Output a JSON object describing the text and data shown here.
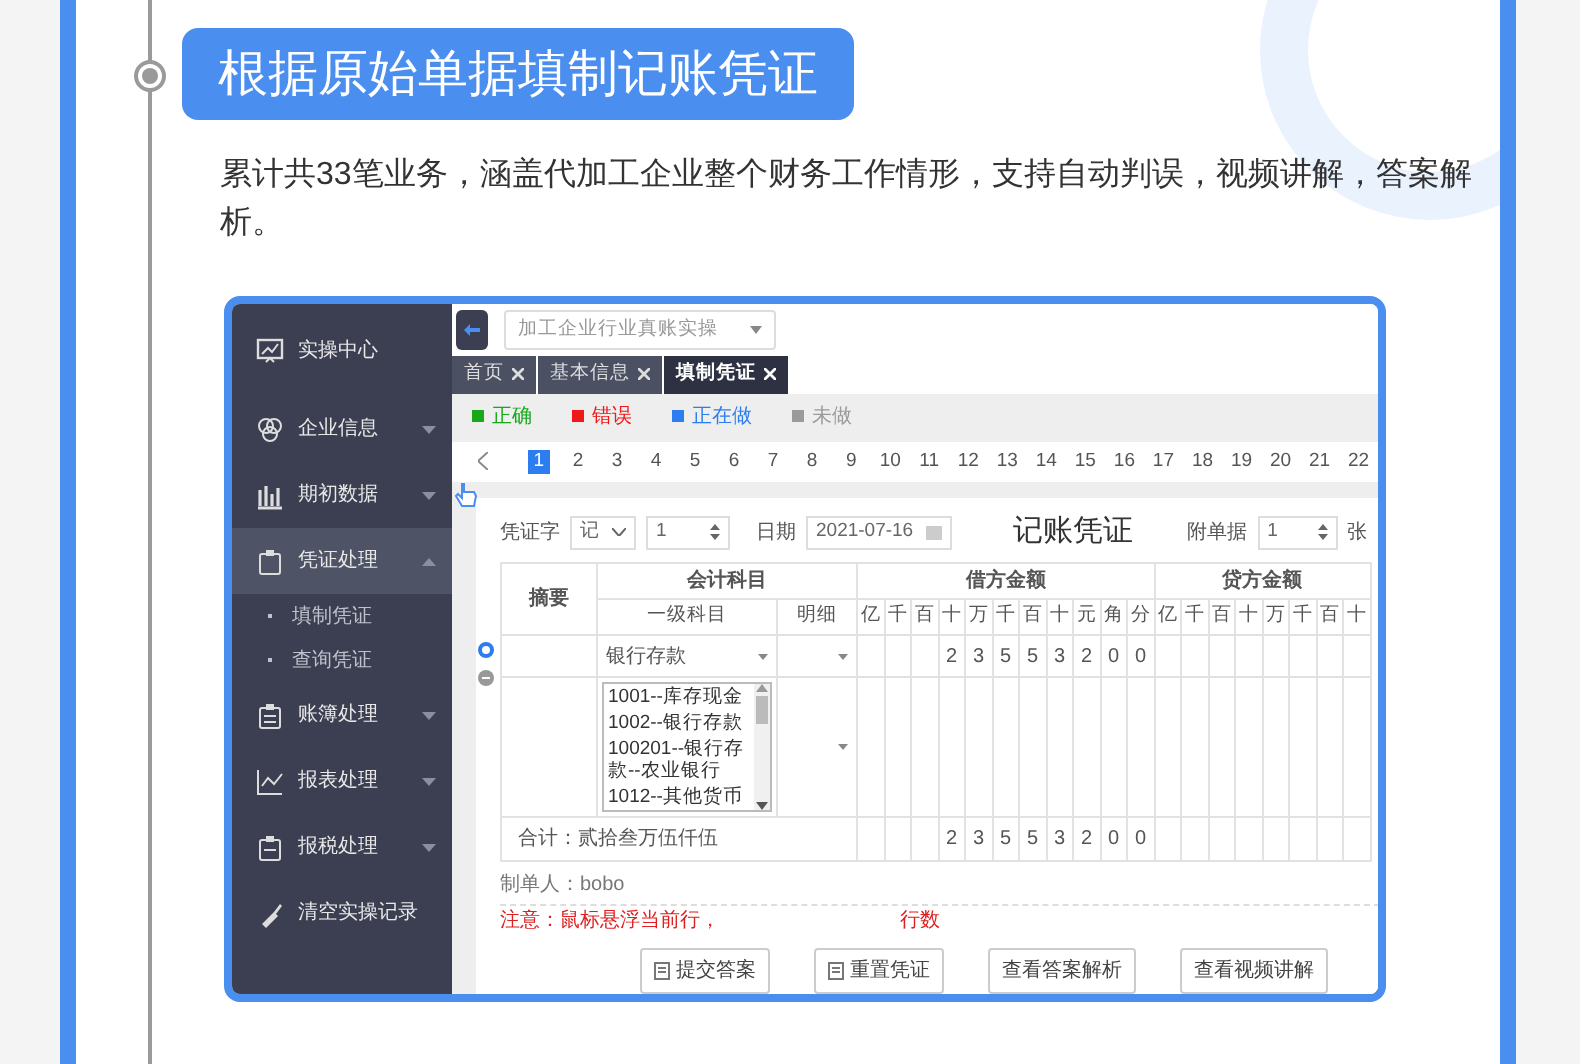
{
  "header": {
    "title": "根据原始单据填制记账凭证",
    "description": "累计共33笔业务，涵盖代加工企业整个财务工作情形，支持自动判误，视频讲解，答案解析。"
  },
  "app": {
    "sidebar": {
      "items": [
        {
          "label": "实操中心",
          "kind": "link",
          "selected": false
        },
        {
          "label": "企业信息",
          "kind": "group",
          "selected": false,
          "expanded": false
        },
        {
          "label": "期初数据",
          "kind": "group",
          "selected": false,
          "expanded": false
        },
        {
          "label": "凭证处理",
          "kind": "group",
          "selected": true,
          "expanded": true,
          "children": [
            {
              "label": "填制凭证",
              "selected": false
            },
            {
              "label": "查询凭证",
              "selected": false
            }
          ]
        },
        {
          "label": "账簿处理",
          "kind": "group",
          "selected": false,
          "expanded": false
        },
        {
          "label": "报表处理",
          "kind": "group",
          "selected": false,
          "expanded": false
        },
        {
          "label": "报税处理",
          "kind": "group",
          "selected": false,
          "expanded": false
        },
        {
          "label": "清空实操记录",
          "kind": "link",
          "selected": false
        }
      ]
    },
    "top_select": {
      "value": "加工企业行业真账实操"
    },
    "tabs": [
      {
        "label": "首页",
        "selected": false
      },
      {
        "label": "基本信息",
        "selected": false
      },
      {
        "label": "填制凭证",
        "selected": true
      }
    ],
    "legend": [
      {
        "label": "正确",
        "color": "#18a81c"
      },
      {
        "label": "错误",
        "color": "#f01818"
      },
      {
        "label": "正在做",
        "color": "#2c7df0"
      },
      {
        "label": "未做",
        "color": "#9a9a9a"
      }
    ],
    "pagination": {
      "pages": [
        {
          "label": "1",
          "selected": true
        },
        {
          "label": "2",
          "selected": false
        },
        {
          "label": "3",
          "selected": false
        },
        {
          "label": "4",
          "selected": false
        },
        {
          "label": "5",
          "selected": false
        },
        {
          "label": "6",
          "selected": false
        },
        {
          "label": "7",
          "selected": false
        },
        {
          "label": "8",
          "selected": false
        },
        {
          "label": "9",
          "selected": false
        },
        {
          "label": "10",
          "selected": false
        },
        {
          "label": "11",
          "selected": false
        },
        {
          "label": "12",
          "selected": false
        },
        {
          "label": "13",
          "selected": false
        },
        {
          "label": "14",
          "selected": false
        },
        {
          "label": "15",
          "selected": false
        },
        {
          "label": "16",
          "selected": false
        },
        {
          "label": "17",
          "selected": false
        },
        {
          "label": "18",
          "selected": false
        },
        {
          "label": "19",
          "selected": false
        },
        {
          "label": "20",
          "selected": false
        },
        {
          "label": "21",
          "selected": false
        },
        {
          "label": "22",
          "selected": false
        }
      ]
    },
    "voucher": {
      "word_label": "凭证字",
      "word_value": "记",
      "number": "1",
      "date_label": "日期",
      "date": "2021-07-16",
      "title": "记账凭证",
      "attach_label": "附单据",
      "attach_value": "1",
      "attach_unit": "张",
      "table": {
        "summary_header": "摘要",
        "account_header": "会计科目",
        "account_subheaders": [
          "一级科目",
          "明细"
        ],
        "debit_header": "借方金额",
        "credit_header": "贷方金额",
        "debit_units": [
          "亿",
          "千",
          "百",
          "十",
          "万",
          "千",
          "百",
          "十",
          "元",
          "角",
          "分"
        ],
        "credit_units": [
          "亿",
          "千",
          "百",
          "十",
          "万",
          "千",
          "百",
          "十"
        ],
        "rows": [
          {
            "kind": "entry",
            "account": "银行存款",
            "debit": [
              "2",
              "3",
              "5",
              "5",
              "3",
              "2",
              "0",
              "0"
            ]
          },
          {
            "kind": "picker",
            "options": [
              "1001--库存现金",
              "1002--银行存款",
              "100201--银行存款--农业银行",
              "1012--其他货币"
            ]
          }
        ],
        "total": {
          "label": "合计：贰拾叁万伍仟伍",
          "debit": [
            "2",
            "3",
            "5",
            "5",
            "3",
            "2",
            "0",
            "0"
          ]
        }
      },
      "maker": "制单人：bobo",
      "note": [
        "注意：鼠标悬浮当前行，",
        "行数"
      ],
      "buttons": [
        {
          "label": "提交答案",
          "kind": "icon"
        },
        {
          "label": "重置凭证",
          "kind": "icon"
        },
        {
          "label": "查看答案解析",
          "kind": "plain"
        },
        {
          "label": "查看视频讲解",
          "kind": "plain"
        }
      ]
    }
  }
}
